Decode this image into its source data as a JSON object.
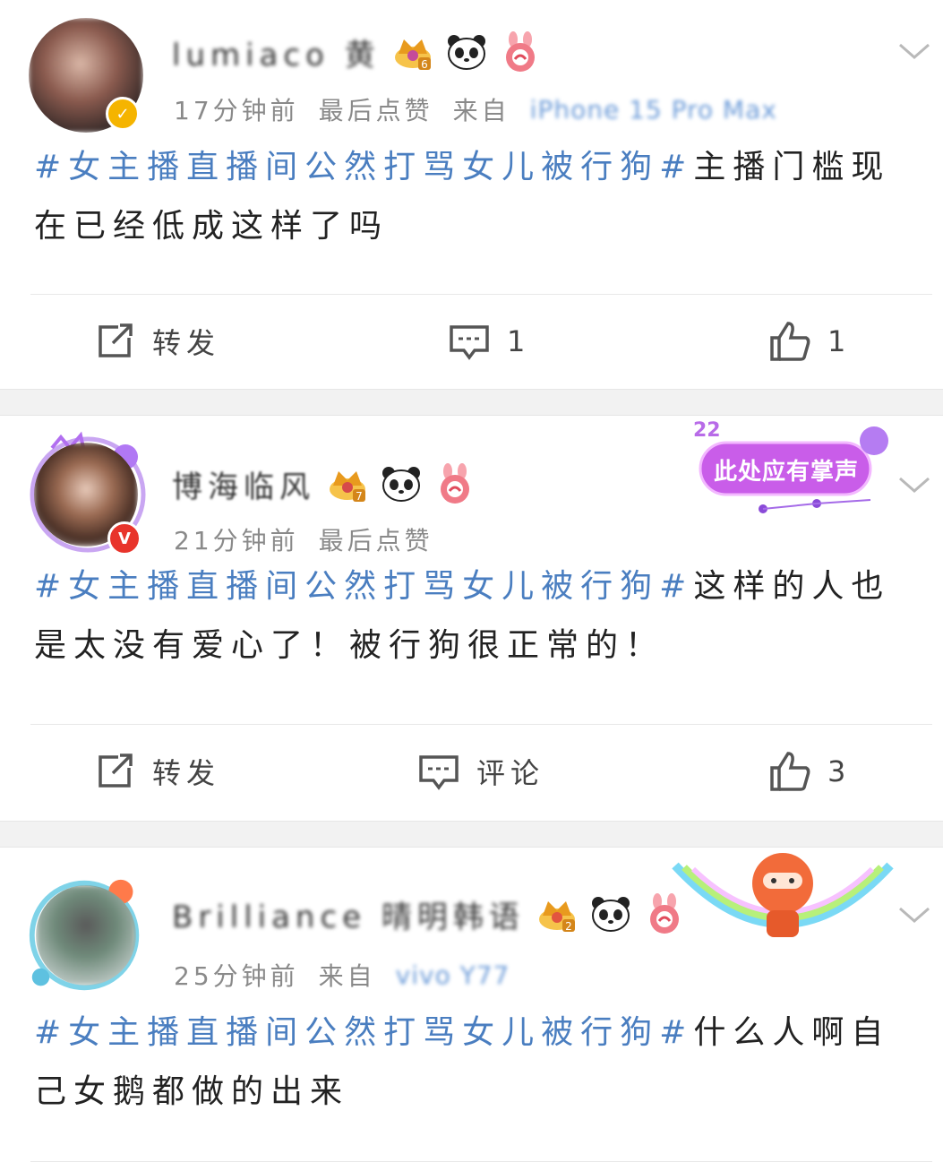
{
  "posts": [
    {
      "username": "lumiaco 黄",
      "level": "6",
      "time": "17分钟前",
      "liked_note": "最后点赞",
      "from_label": "来自",
      "device": "iPhone 15 Pro Max",
      "topic": "#女主播直播间公然打骂女儿被行狗#",
      "text": "主播门槛现在已经低成这样了吗",
      "repost_label": "转发",
      "comment_label": "1",
      "like_count": "1",
      "verify_color": "#f5b400"
    },
    {
      "username": "博海临风",
      "level": "7",
      "time": "21分钟前",
      "liked_note": "最后点赞",
      "deco_text": "此处应有掌声",
      "deco_number": "22",
      "topic": "#女主播直播间公然打骂女儿被行狗#",
      "text": "这样的人也是太没有爱心了！被行狗很正常的！",
      "repost_label": "转发",
      "comment_label": "评论",
      "like_count": "3",
      "verify_color": "#e8342b"
    },
    {
      "username": "Brilliance 晴明韩语",
      "level": "2",
      "time": "25分钟前",
      "from_label": "来自",
      "device": "vivo Y77",
      "topic": "#女主播直播间公然打骂女儿被行狗#",
      "text": "什么人啊自己女鹅都做的出来"
    }
  ],
  "icons": [
    "chevron-down-icon",
    "repost-icon",
    "comment-icon",
    "like-icon",
    "crown-level-icon",
    "panda-icon",
    "rabbit-icon"
  ],
  "colors": {
    "topic": "#4a7ec0",
    "meta": "#8a8a8a",
    "separator": "#f2f2f2"
  }
}
